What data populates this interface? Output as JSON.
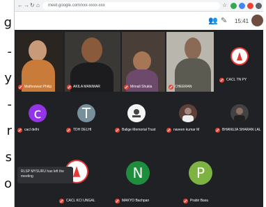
{
  "left_text": [
    "g",
    "-",
    "y",
    "-",
    "r",
    "s",
    "o"
  ],
  "browser": {
    "nav": [
      "←",
      "→",
      "↻",
      "⌂"
    ],
    "url": "meet.google.com/xxx-xxxx-xxx",
    "star": "☆",
    "ext_colors": [
      "#34a853",
      "#4285f4",
      "#ea4335",
      "#5f6368"
    ]
  },
  "meet": {
    "clock": "15:41",
    "icons": [
      "people-icon",
      "chat-icon",
      "more-icon"
    ]
  },
  "tiles": [
    {
      "name": "Matheswari Philip",
      "bg": "#2b2522"
    },
    {
      "name": "AKILA MANIMAR",
      "bg": "#3a3834"
    },
    {
      "name": "Mrinali Shukla",
      "bg": "#4a3f38"
    },
    {
      "name": "CHEERAN",
      "bg": "#b9b6ae"
    }
  ],
  "grid": [
    {
      "name": "CACL TN PY",
      "letter": "",
      "av_color": "#ffffff",
      "kind": "logo"
    },
    {
      "name": "cacl delhi",
      "letter": "c",
      "av_color": "#9334e6",
      "kind": "letter"
    },
    {
      "name": "TDH DELHI",
      "letter": "T",
      "av_color": "#78909c",
      "kind": "letter"
    },
    {
      "name": "Balige Memorial Trust",
      "letter": "",
      "av_color": "#f5f5f5",
      "kind": "logo"
    },
    {
      "name": "naveen kumar M",
      "letter": "",
      "av_color": "#5d4037",
      "kind": "photo"
    },
    {
      "name": "BHANUJA SHARAN LAL",
      "letter": "",
      "av_color": "#424242",
      "kind": "photo"
    },
    {
      "name": "CACL KCI UNGAL",
      "letter": "",
      "av_color": "#ffffff",
      "kind": "logo"
    },
    {
      "name": "MAKYO Bachpan",
      "letter": "N",
      "av_color": "#1e8e3e",
      "kind": "letter"
    },
    {
      "name": "Prabir Basu",
      "letter": "P",
      "av_color": "#7cb342",
      "kind": "letter"
    }
  ],
  "toast": "RLSP MYSURU has left the meeting"
}
